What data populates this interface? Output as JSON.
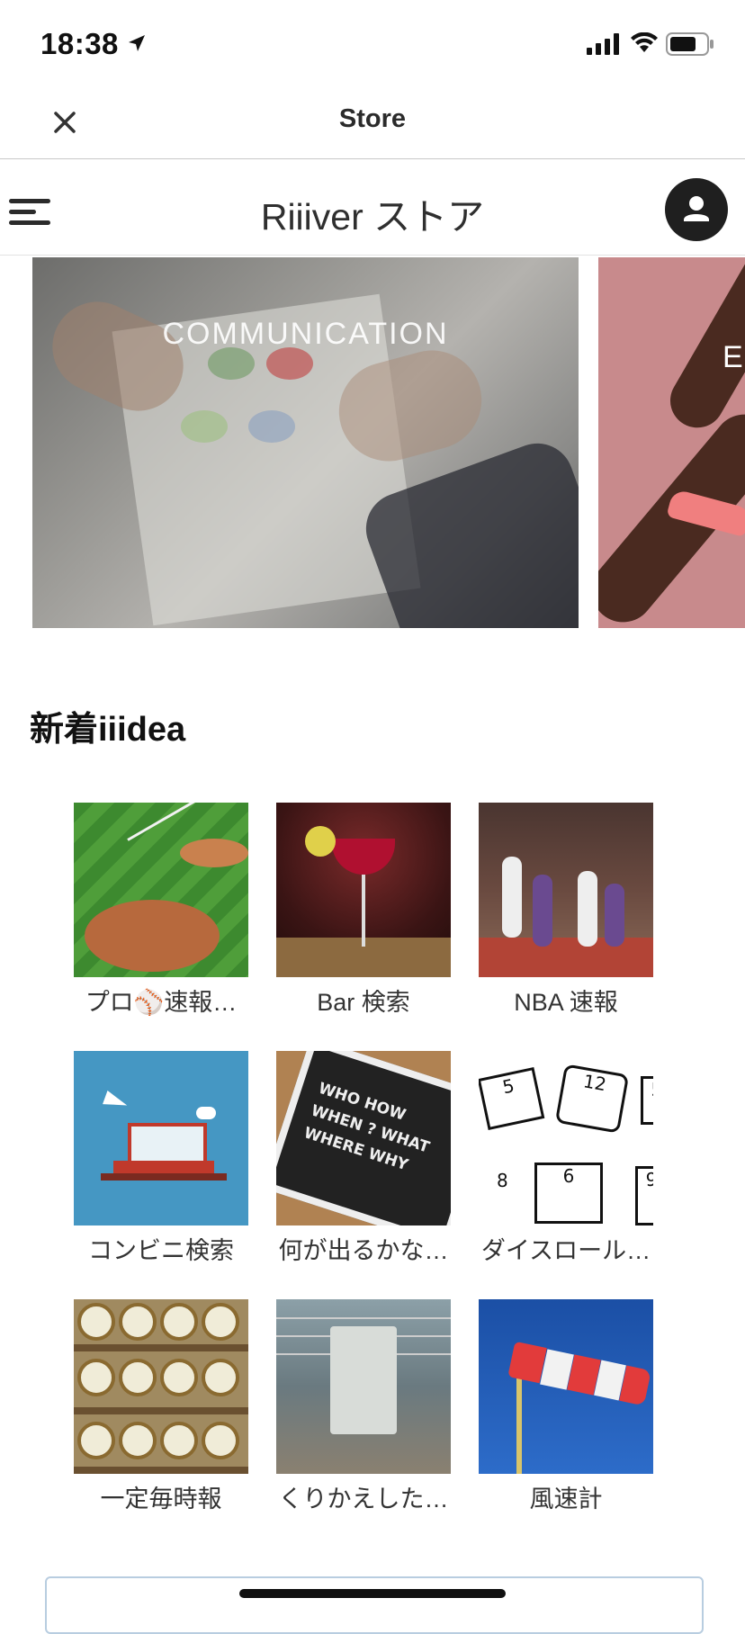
{
  "status_bar": {
    "time": "18:38"
  },
  "navbar": {
    "title": "Store"
  },
  "store_header": {
    "title": "Riiiver ストア"
  },
  "carousel": {
    "slides": [
      {
        "label": "COMMUNICATION"
      },
      {
        "label": "E"
      }
    ]
  },
  "section": {
    "title": "新着iiidea",
    "items": [
      {
        "caption": "プロ⚾速報…",
        "image": "baseball-field"
      },
      {
        "caption": "Bar 検索",
        "image": "cocktail"
      },
      {
        "caption": "NBA 速報",
        "image": "basketball-game"
      },
      {
        "caption": "コンビニ検索",
        "image": "convenience-store-illustration"
      },
      {
        "caption": "何が出るかな…",
        "image": "chalkboard-questions"
      },
      {
        "caption": "ダイスロール…",
        "image": "dice-drawing"
      },
      {
        "caption": "一定毎時報",
        "image": "alarm-clocks"
      },
      {
        "caption": "くりかえした…",
        "image": "hallway"
      },
      {
        "caption": "風速計",
        "image": "windsock"
      }
    ]
  },
  "chalk_words": [
    "WHO HOW",
    "WHEN ? WHAT",
    "WHERE WHY"
  ],
  "dice_faces": [
    "5",
    "12",
    "8",
    "6",
    "5",
    "9"
  ]
}
